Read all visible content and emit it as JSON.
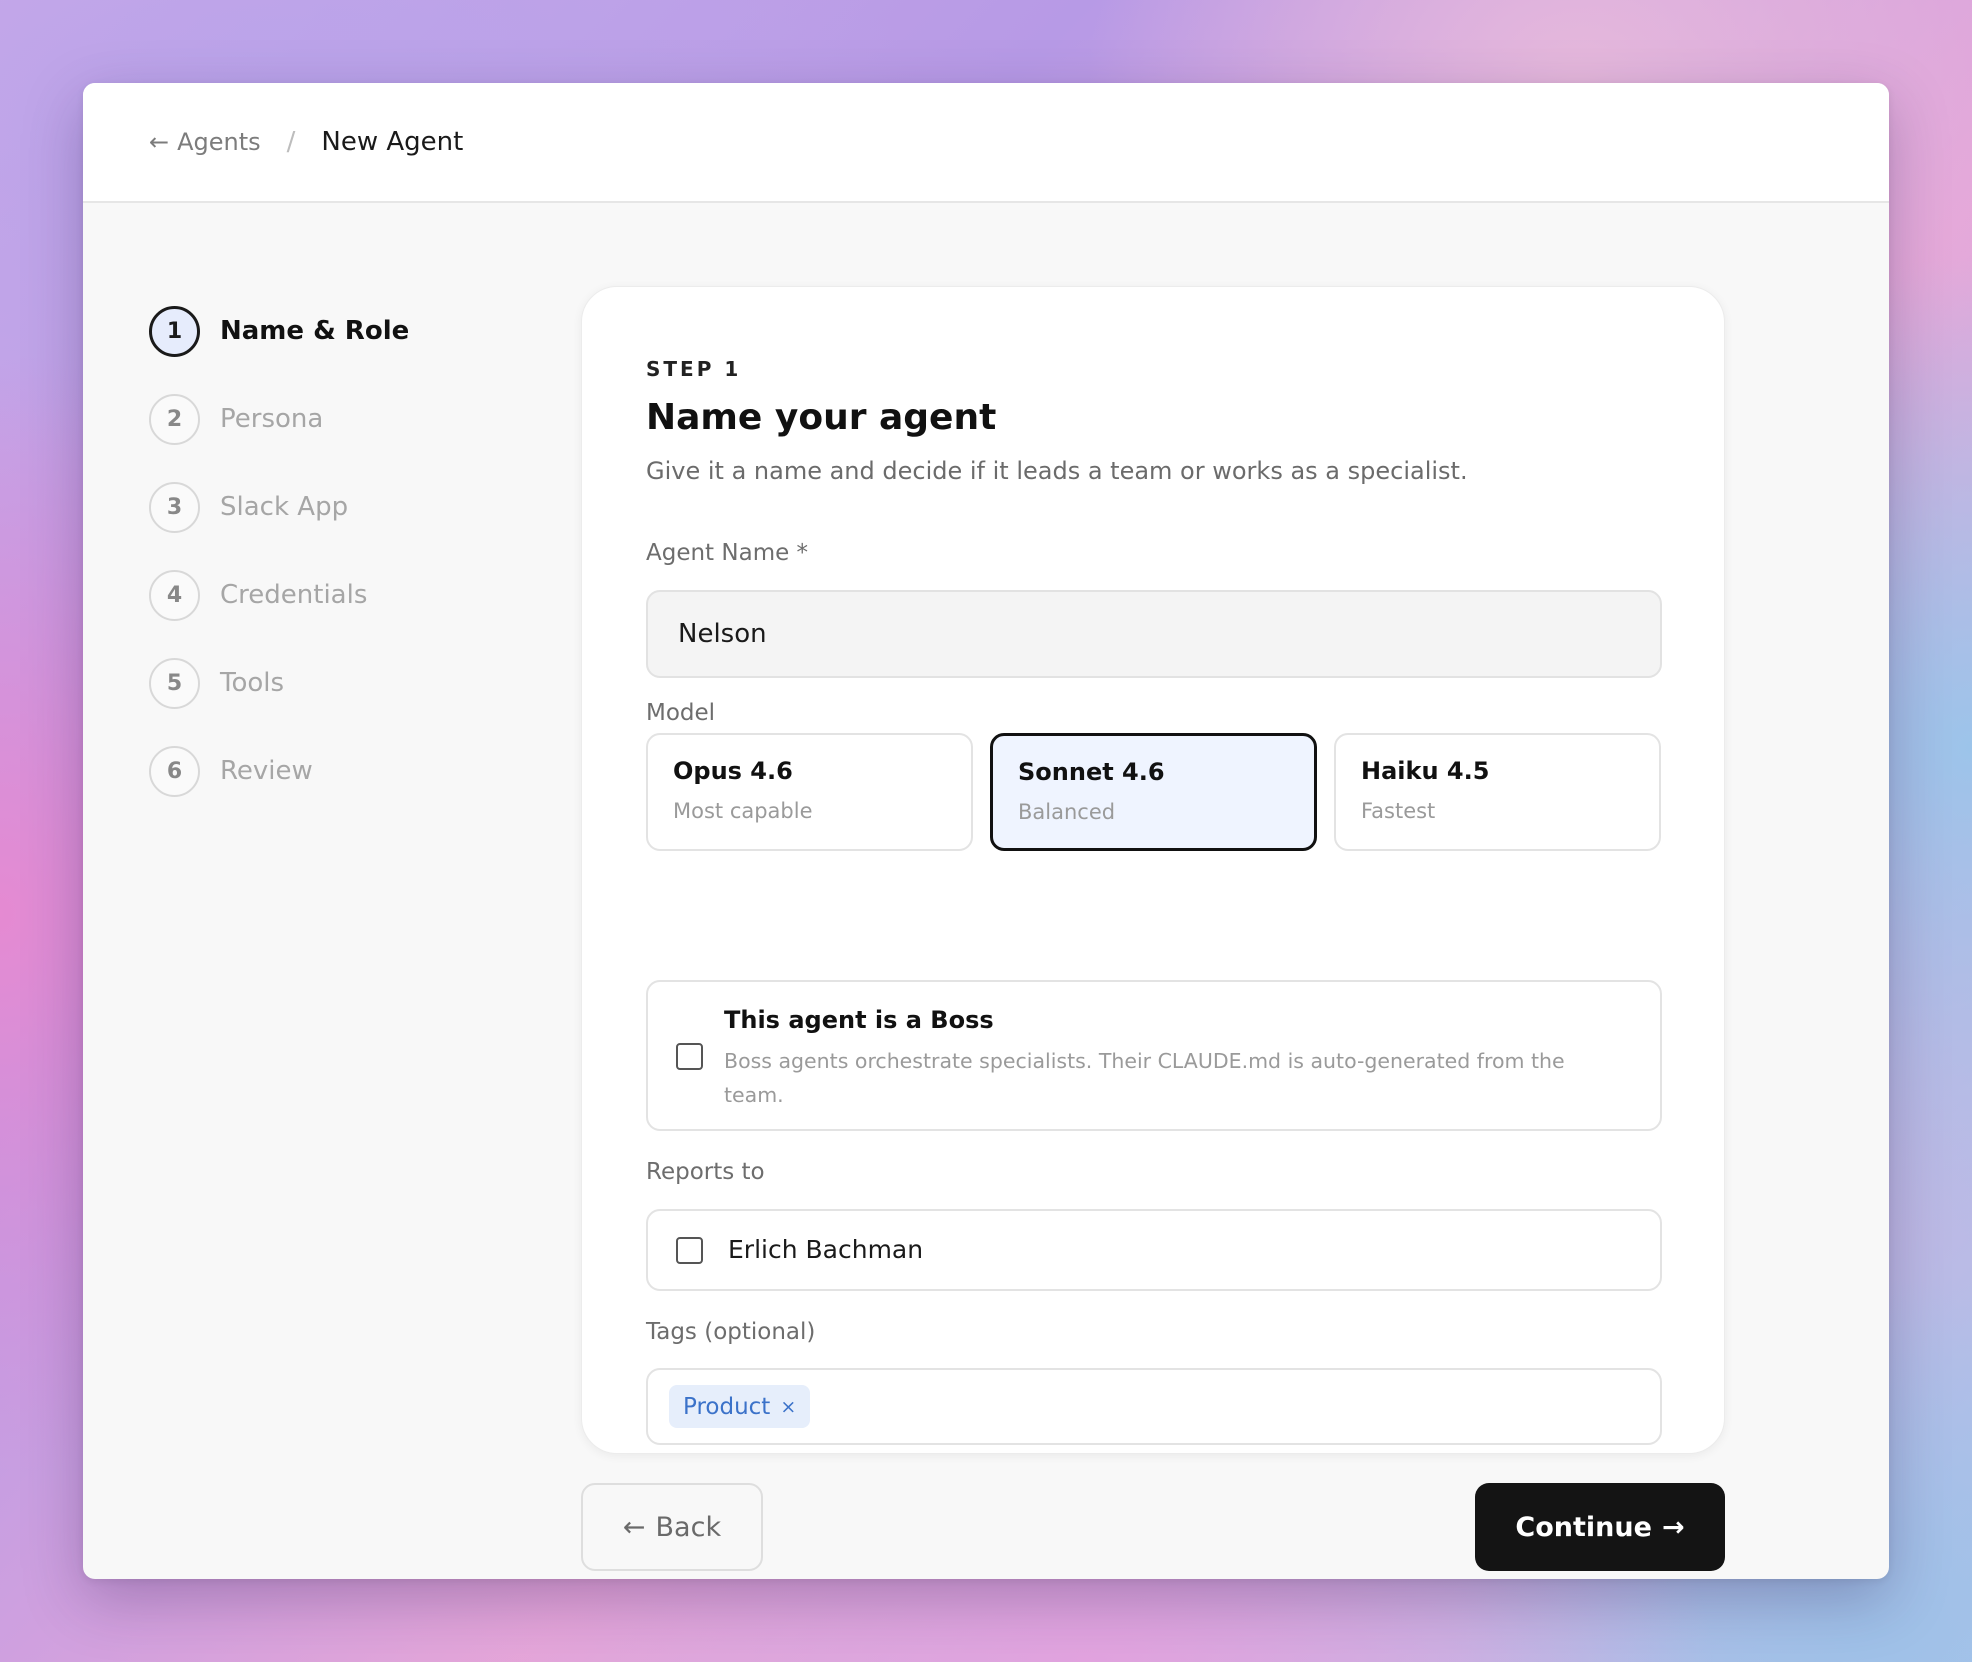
{
  "breadcrumb": {
    "back_arrow": "←",
    "back_label": "Agents",
    "separator": "/",
    "current": "New Agent"
  },
  "steps": [
    {
      "number": "1",
      "label": "Name & Role",
      "state": "active"
    },
    {
      "number": "2",
      "label": "Persona",
      "state": "inactive"
    },
    {
      "number": "3",
      "label": "Slack App",
      "state": "inactive"
    },
    {
      "number": "4",
      "label": "Credentials",
      "state": "inactive"
    },
    {
      "number": "5",
      "label": "Tools",
      "state": "inactive"
    },
    {
      "number": "6",
      "label": "Review",
      "state": "inactive"
    }
  ],
  "form": {
    "eyebrow": "STEP 1",
    "title": "Name your agent",
    "subtitle": "Give it a name and decide if it leads a team or works as a specialist.",
    "agent_name_label": "Agent Name *",
    "agent_name_value": "Nelson",
    "model_label": "Model",
    "models": [
      {
        "name": "Opus 4.6",
        "desc": "Most capable",
        "selected": false
      },
      {
        "name": "Sonnet 4.6",
        "desc": "Balanced",
        "selected": true
      },
      {
        "name": "Haiku 4.5",
        "desc": "Fastest",
        "selected": false
      }
    ],
    "boss": {
      "title": "This agent is a Boss",
      "description": "Boss agents orchestrate specialists. Their CLAUDE.md is auto-generated from the team.",
      "checked": false
    },
    "reports_to_label": "Reports to",
    "reports_to": {
      "name": "Erlich Bachman",
      "checked": false
    },
    "tags_label": "Tags (optional)",
    "tags": [
      {
        "label": "Product",
        "remove": "×"
      }
    ]
  },
  "actions": {
    "back_arrow": "←",
    "back_label": "Back",
    "continue_label": "Continue",
    "continue_arrow": "→"
  },
  "colors": {
    "accent_dark": "#141414",
    "selected_bg": "#eff4ff",
    "tag_bg": "#e6eefb",
    "tag_text": "#3b72c9"
  }
}
